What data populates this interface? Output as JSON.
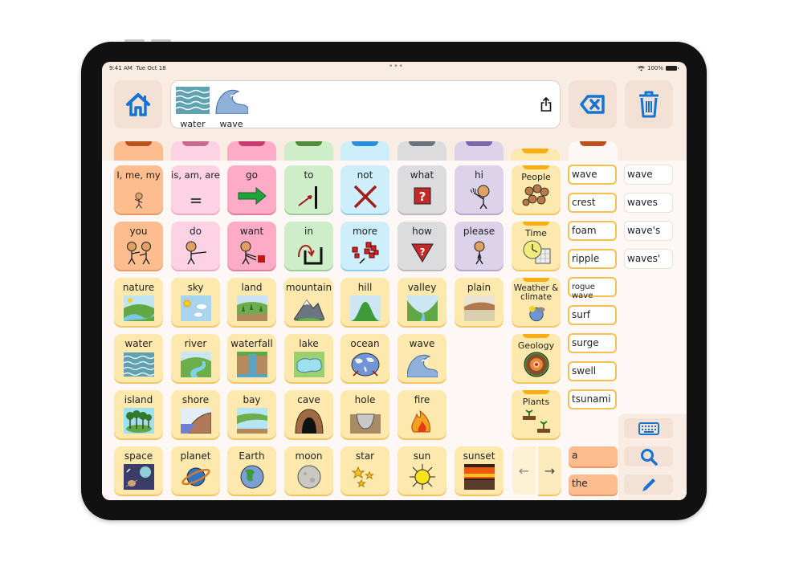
{
  "status_bar": {
    "time": "9:41 AM",
    "date": "Tue Oct 18",
    "multitask_dots": "•••",
    "battery": "100%"
  },
  "toolbar": {
    "home_icon": "house-icon",
    "message": [
      {
        "word": "water",
        "icon": "water-waves-icon"
      },
      {
        "word": "wave",
        "icon": "wave-icon"
      }
    ],
    "share_icon": "share-icon",
    "backspace_icon": "delete-backward-icon",
    "clear_icon": "trash-icon"
  },
  "colors": {
    "accent_blue": "#1474d4",
    "background": "#f8ece3",
    "tabs": [
      "#b9521d",
      "#c66a8e",
      "#c93a6f",
      "#548a3b",
      "#2c8ed6",
      "#6c727c",
      "#7868a8",
      "#f9ad0e",
      "#b9521d"
    ]
  },
  "grid": {
    "core_rows": [
      [
        {
          "label": "I, me, my",
          "icon": "person-self-icon",
          "color": "orange"
        },
        {
          "label": "is, am, are",
          "icon": "equals-icon",
          "color": "pink"
        },
        {
          "label": "go",
          "icon": "green-arrow-icon",
          "color": "rose"
        },
        {
          "label": "to",
          "icon": "arrow-to-line-icon",
          "color": "green"
        },
        {
          "label": "not",
          "icon": "red-x-icon",
          "color": "blue"
        },
        {
          "label": "what",
          "icon": "question-box-icon",
          "color": "gray"
        },
        {
          "label": "hi",
          "icon": "waving-person-icon",
          "color": "purple"
        }
      ],
      [
        {
          "label": "you",
          "icon": "two-people-icon",
          "color": "orange"
        },
        {
          "label": "do",
          "icon": "person-pointing-icon",
          "color": "pink"
        },
        {
          "label": "want",
          "icon": "person-reaching-icon",
          "color": "rose"
        },
        {
          "label": "in",
          "icon": "arrow-into-box-icon",
          "color": "green"
        },
        {
          "label": "more",
          "icon": "more-blocks-icon",
          "color": "blue"
        },
        {
          "label": "how",
          "icon": "question-triangle-icon",
          "color": "gray"
        },
        {
          "label": "please",
          "icon": "person-please-icon",
          "color": "purple"
        }
      ]
    ],
    "fringe_rows": [
      [
        {
          "label": "nature",
          "icon": "nature-scene-icon"
        },
        {
          "label": "sky",
          "icon": "sky-sun-icon"
        },
        {
          "label": "land",
          "icon": "land-icon"
        },
        {
          "label": "mountain",
          "icon": "mountain-icon"
        },
        {
          "label": "hill",
          "icon": "hill-icon"
        },
        {
          "label": "valley",
          "icon": "valley-icon"
        },
        {
          "label": "plain",
          "icon": "plain-icon"
        }
      ],
      [
        {
          "label": "water",
          "icon": "water-waves-icon"
        },
        {
          "label": "river",
          "icon": "river-icon"
        },
        {
          "label": "waterfall",
          "icon": "waterfall-icon"
        },
        {
          "label": "lake",
          "icon": "lake-icon"
        },
        {
          "label": "ocean",
          "icon": "globe-ocean-icon"
        },
        {
          "label": "wave",
          "icon": "wave-icon"
        }
      ],
      [
        {
          "label": "island",
          "icon": "island-icon"
        },
        {
          "label": "shore",
          "icon": "shore-icon"
        },
        {
          "label": "bay",
          "icon": "bay-icon"
        },
        {
          "label": "cave",
          "icon": "cave-icon"
        },
        {
          "label": "hole",
          "icon": "hole-icon"
        },
        {
          "label": "fire",
          "icon": "fire-icon"
        }
      ],
      [
        {
          "label": "space",
          "icon": "space-icon"
        },
        {
          "label": "planet",
          "icon": "planet-icon"
        },
        {
          "label": "Earth",
          "icon": "earth-icon"
        },
        {
          "label": "moon",
          "icon": "moon-icon"
        },
        {
          "label": "star",
          "icon": "stars-icon"
        },
        {
          "label": "sun",
          "icon": "sun-icon"
        },
        {
          "label": "sunset",
          "icon": "sunset-icon"
        }
      ]
    ]
  },
  "categories": [
    {
      "label": "People",
      "icon": "people-faces-icon"
    },
    {
      "label": "Time",
      "icon": "clock-calendar-icon"
    },
    {
      "label": "Weather & climate",
      "icon": "weather-globe-icon"
    },
    {
      "label": "Geology",
      "icon": "earth-layers-icon"
    },
    {
      "label": "Plants",
      "icon": "seedling-icon"
    }
  ],
  "nav": {
    "prev": "←",
    "next": "→"
  },
  "predictions": [
    "wave",
    "crest",
    "foam",
    "ripple",
    "rogue wave",
    "surf",
    "surge",
    "swell",
    "tsunami"
  ],
  "inflections": [
    "wave",
    "waves",
    "wave's",
    "waves'"
  ],
  "articles": [
    "a",
    "the"
  ],
  "tools": {
    "keyboard_icon": "keyboard-icon",
    "search_icon": "search-icon",
    "edit_icon": "pencil-icon"
  }
}
